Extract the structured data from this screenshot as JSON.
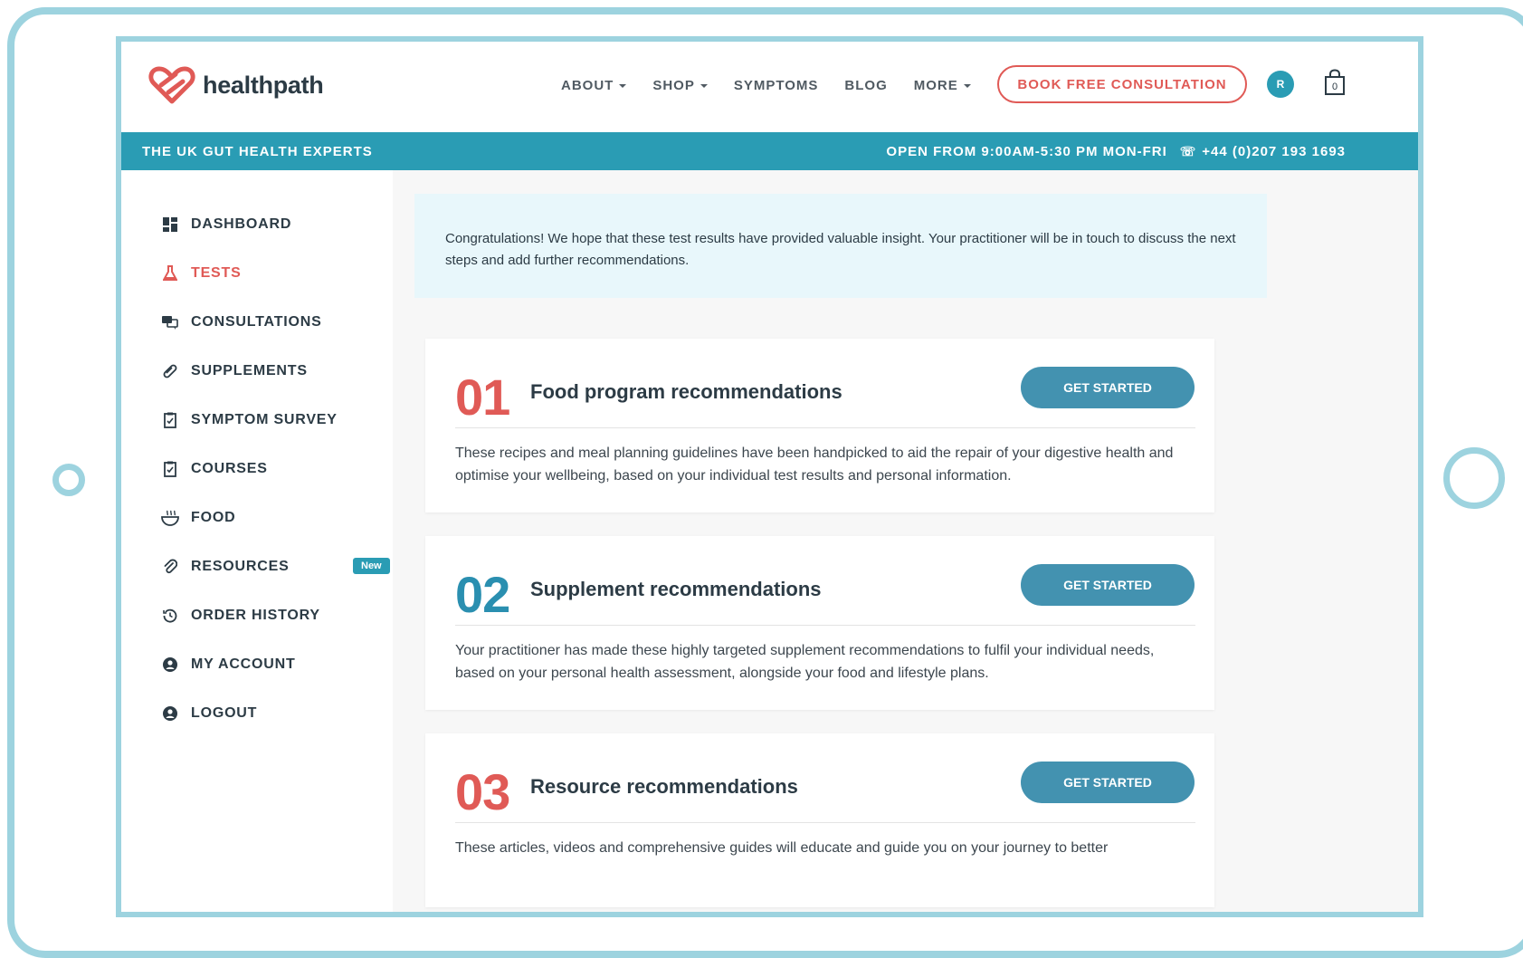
{
  "brand": {
    "name": "healthpath",
    "logo_color": "#e05a56"
  },
  "nav": {
    "items": [
      {
        "label": "ABOUT",
        "dropdown": true
      },
      {
        "label": "SHOP",
        "dropdown": true
      },
      {
        "label": "SYMPTOMS",
        "dropdown": false
      },
      {
        "label": "BLOG",
        "dropdown": false
      },
      {
        "label": "MORE",
        "dropdown": true
      }
    ],
    "cta_label": "BOOK FREE CONSULTATION",
    "avatar_initial": "R",
    "cart_count": "0"
  },
  "topbar": {
    "tagline": "THE UK GUT HEALTH EXPERTS",
    "hours": "OPEN FROM 9:00AM-5:30 PM MON-FRI",
    "phone": "+44 (0)207 193 1693"
  },
  "sidebar": {
    "items": [
      {
        "label": "DASHBOARD",
        "icon": "dashboard-icon"
      },
      {
        "label": "TESTS",
        "icon": "flask-icon",
        "active": true
      },
      {
        "label": "CONSULTATIONS",
        "icon": "chat-icon"
      },
      {
        "label": "SUPPLEMENTS",
        "icon": "pill-icon"
      },
      {
        "label": "SYMPTOM SURVEY",
        "icon": "clipboard-icon"
      },
      {
        "label": "COURSES",
        "icon": "clipboard-icon"
      },
      {
        "label": "FOOD",
        "icon": "bowl-icon"
      },
      {
        "label": "RESOURCES",
        "icon": "paperclip-icon",
        "badge": "New"
      },
      {
        "label": "ORDER HISTORY",
        "icon": "history-icon"
      },
      {
        "label": "MY ACCOUNT",
        "icon": "user-icon"
      },
      {
        "label": "LOGOUT",
        "icon": "user-icon"
      }
    ]
  },
  "alert": {
    "text": "Congratulations! We hope that these test results have provided valuable insight. Your practitioner will be in touch to discuss the next steps and add further recommendations."
  },
  "cards": [
    {
      "number": "01",
      "number_color": "#e05a56",
      "title": "Food program recommendations",
      "button": "GET STARTED",
      "description": "These recipes and meal planning guidelines have been handpicked to aid the repair of your digestive health and optimise your wellbeing, based on your individual test results and personal information."
    },
    {
      "number": "02",
      "number_color": "#2a8fb0",
      "title": "Supplement recommendations",
      "button": "GET STARTED",
      "description": "Your practitioner has made these highly targeted supplement recommendations to fulfil your individual needs, based on your personal health assessment, alongside your food and lifestyle plans."
    },
    {
      "number": "03",
      "number_color": "#e05a56",
      "title": "Resource recommendations",
      "button": "GET STARTED",
      "description": "These articles, videos and comprehensive guides will educate and guide you on your journey to better"
    }
  ],
  "colors": {
    "teal": "#2a9cb4",
    "coral": "#e05a56",
    "button_blue": "#4392b0",
    "frame": "#9dd3df"
  }
}
